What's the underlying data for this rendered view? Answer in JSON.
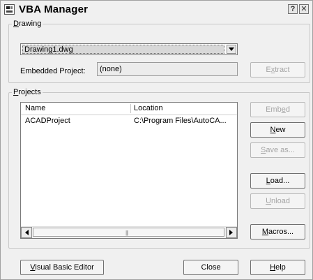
{
  "window": {
    "title": "VBA Manager",
    "help_button": "?",
    "close_button": "✕"
  },
  "drawing_group": {
    "legend_mnemonic": "D",
    "legend_rest": "rawing",
    "selected_drawing": "Drawing1.dwg",
    "embedded_label": "Embedded Project:",
    "embedded_value": "(none)",
    "extract_mnemonic": "x",
    "extract_pre": "E",
    "extract_post": "tract"
  },
  "projects_group": {
    "legend_mnemonic": "P",
    "legend_rest": "rojects",
    "columns": [
      "Name",
      "Location"
    ],
    "rows": [
      {
        "name": "ACADProject",
        "location": "C:\\Program Files\\AutoCA..."
      }
    ]
  },
  "buttons": {
    "embed_pre": "Emb",
    "embed_mnemonic": "e",
    "embed_post": "d",
    "new_mnemonic": "N",
    "new_post": "ew",
    "saveas_mnemonic": "S",
    "saveas_post": "ave as...",
    "load_mnemonic": "L",
    "load_post": "oad...",
    "unload_mnemonic": "U",
    "unload_post": "nload",
    "macros_mnemonic": "M",
    "macros_post": "acros...",
    "vbe_mnemonic": "V",
    "vbe_post": "isual Basic Editor",
    "close_label": "Close",
    "help_mnemonic": "H",
    "help_post": "elp"
  },
  "icons": {
    "app": "vba-manager-icon",
    "combo_arrow": "chevron-down-icon",
    "scroll_left": "arrow-left-icon",
    "scroll_right": "arrow-right-icon"
  }
}
